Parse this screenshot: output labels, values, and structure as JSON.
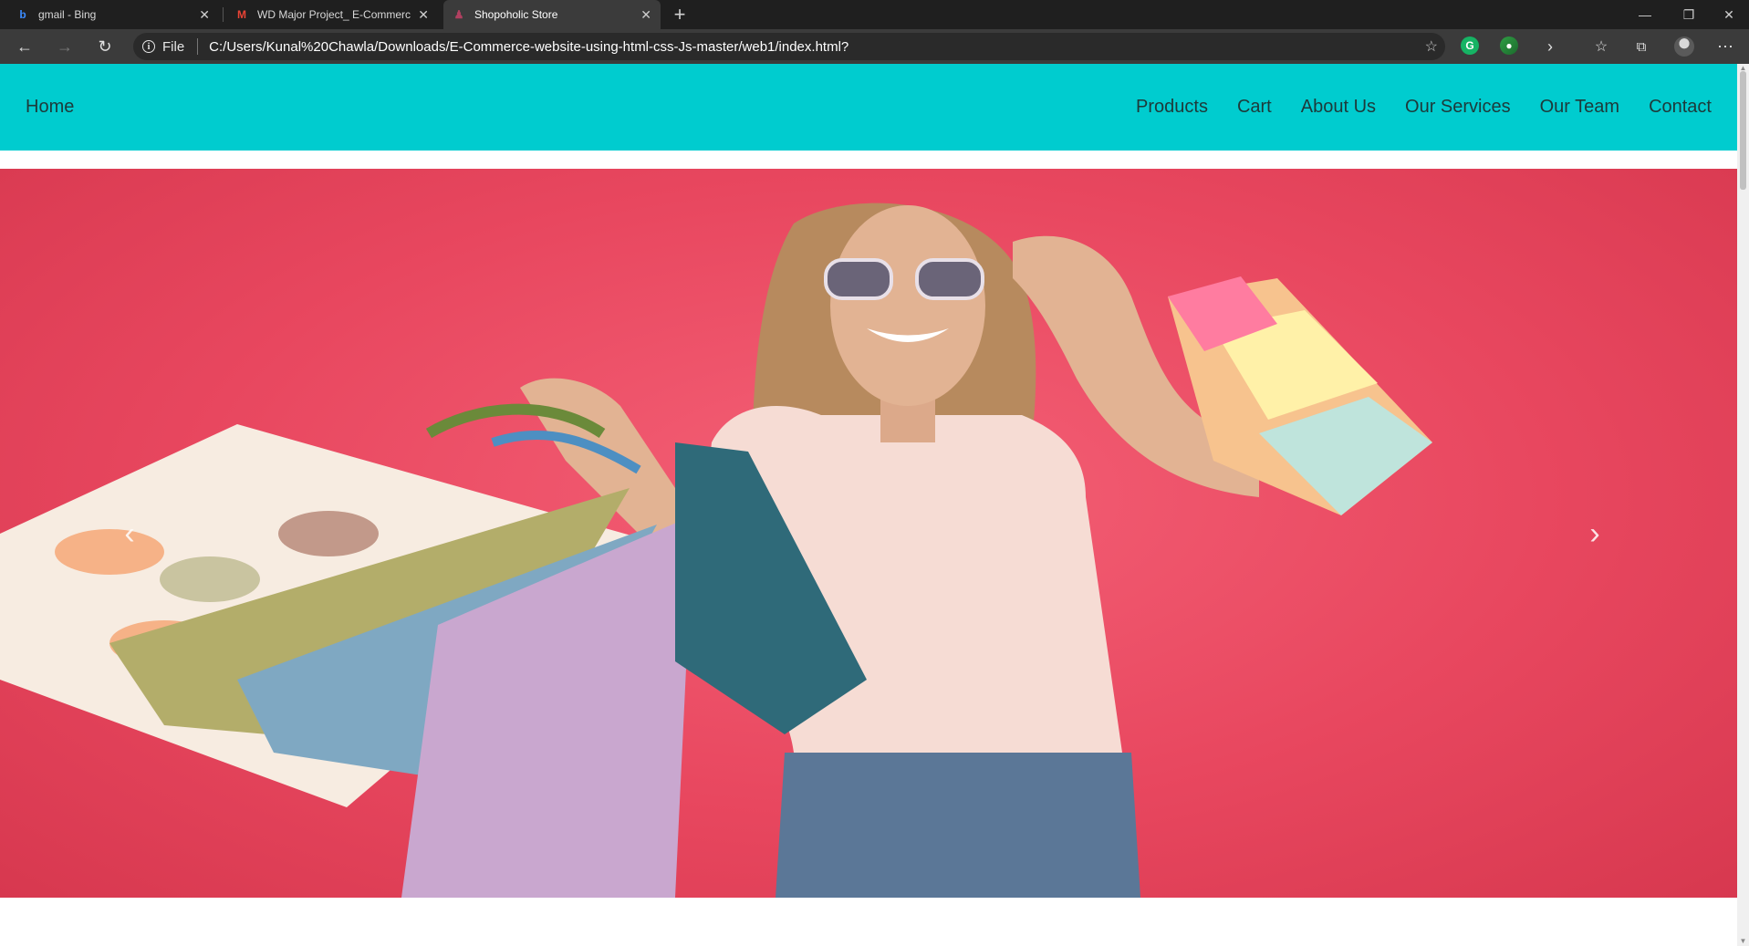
{
  "browser": {
    "tabs": [
      {
        "title": "gmail - Bing",
        "icon": "bing-icon",
        "active": false
      },
      {
        "title": "WD Major Project_ E-Commerce",
        "icon": "gmail-icon",
        "active": false
      },
      {
        "title": "Shopoholic Store",
        "icon": "site-icon",
        "active": true
      }
    ],
    "address": {
      "scheme_label": "File",
      "url": "C:/Users/Kunal%20Chawla/Downloads/E-Commerce-website-using-html-css-Js-master/web1/index.html?"
    }
  },
  "navbar": {
    "home": "Home",
    "links": [
      "Products",
      "Cart",
      "About Us",
      "Our Services",
      "Our Team",
      "Contact"
    ],
    "background": "#00cccf"
  },
  "carousel": {
    "prev_icon": "chevron-left-icon",
    "next_icon": "chevron-right-icon",
    "prev_glyph": "‹",
    "next_glyph": "›",
    "background": "#e8475f"
  }
}
